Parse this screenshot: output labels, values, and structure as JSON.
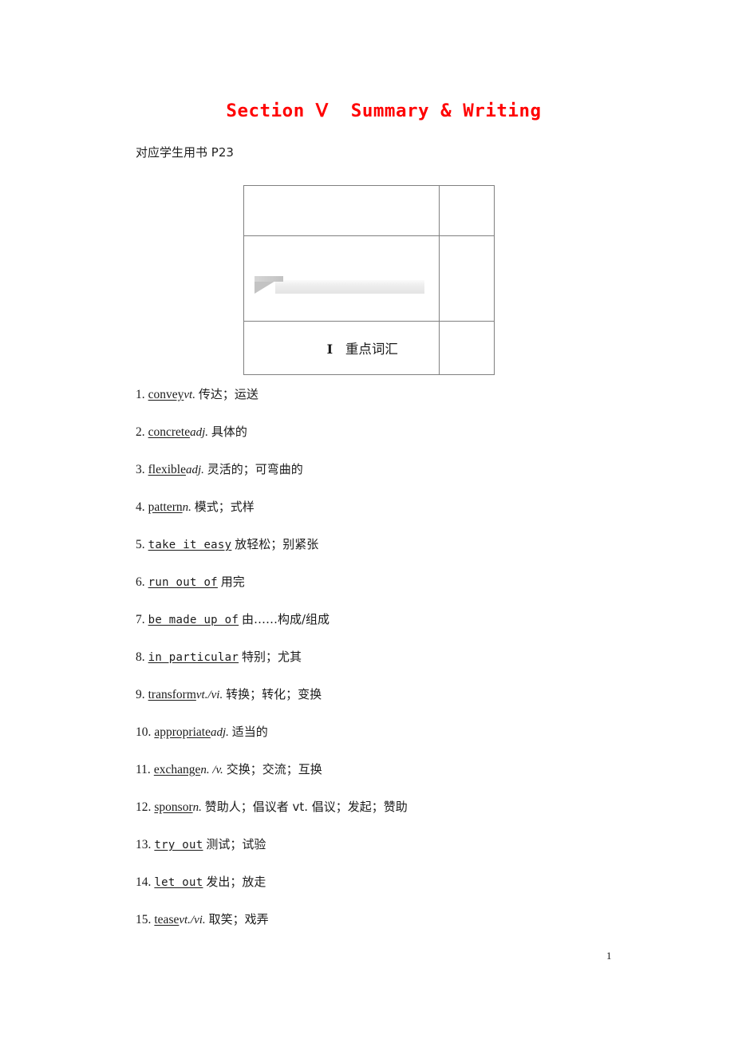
{
  "document": {
    "title": "Section Ⅴ  Summary & Writing",
    "title_color": "#ff0000",
    "reference_line": "对应学生用书 P23",
    "page_number": "1"
  },
  "info_table": {
    "banner_graphic": "decorative-banner",
    "heading": {
      "numeral": "Ⅰ",
      "text": "重点词汇"
    }
  },
  "vocabulary": {
    "items": [
      {
        "num": "1.",
        "term": "convey",
        "pos": "vt.",
        "def": "传达；运送",
        "is_phrase": false
      },
      {
        "num": "2.",
        "term": "concrete",
        "pos": "adj.",
        "def": "具体的",
        "is_phrase": false
      },
      {
        "num": "3.",
        "term": "flexible",
        "pos": "adj.",
        "def": "灵活的；可弯曲的",
        "is_phrase": false
      },
      {
        "num": "4.",
        "term": "pattern",
        "pos": "n.",
        "def": "模式；式样",
        "is_phrase": false
      },
      {
        "num": "5.",
        "term": "take it easy",
        "pos": "",
        "def": "放轻松；别紧张",
        "is_phrase": true
      },
      {
        "num": "6.",
        "term": "run out of",
        "pos": "",
        "def": "用完",
        "is_phrase": true
      },
      {
        "num": "7.",
        "term": "be made up of",
        "pos": "",
        "def": "由……构成/组成",
        "is_phrase": true
      },
      {
        "num": "8.",
        "term": "in particular",
        "pos": "",
        "def": "特别；尤其",
        "is_phrase": true
      },
      {
        "num": "9.",
        "term": "transform",
        "pos": "vt./vi.",
        "def": "转换；转化；变换",
        "is_phrase": false
      },
      {
        "num": "10.",
        "term": "appropriate",
        "pos": "adj.",
        "def": "适当的",
        "is_phrase": false
      },
      {
        "num": "11.",
        "term": "exchange",
        "pos": "n. /v.",
        "def": "交换；交流；互换",
        "is_phrase": false
      },
      {
        "num": "12.",
        "term": "sponsor",
        "pos": "n.",
        "def": "赞助人；倡议者 vt. 倡议；发起；赞助",
        "is_phrase": false
      },
      {
        "num": "13.",
        "term": "try out",
        "pos": "",
        "def": "测试；试验",
        "is_phrase": true
      },
      {
        "num": "14.",
        "term": "let out",
        "pos": "",
        "def": "发出；放走",
        "is_phrase": true
      },
      {
        "num": "15.",
        "term": "tease",
        "pos": "vt./vi.",
        "def": "取笑；戏弄",
        "is_phrase": false
      }
    ]
  }
}
